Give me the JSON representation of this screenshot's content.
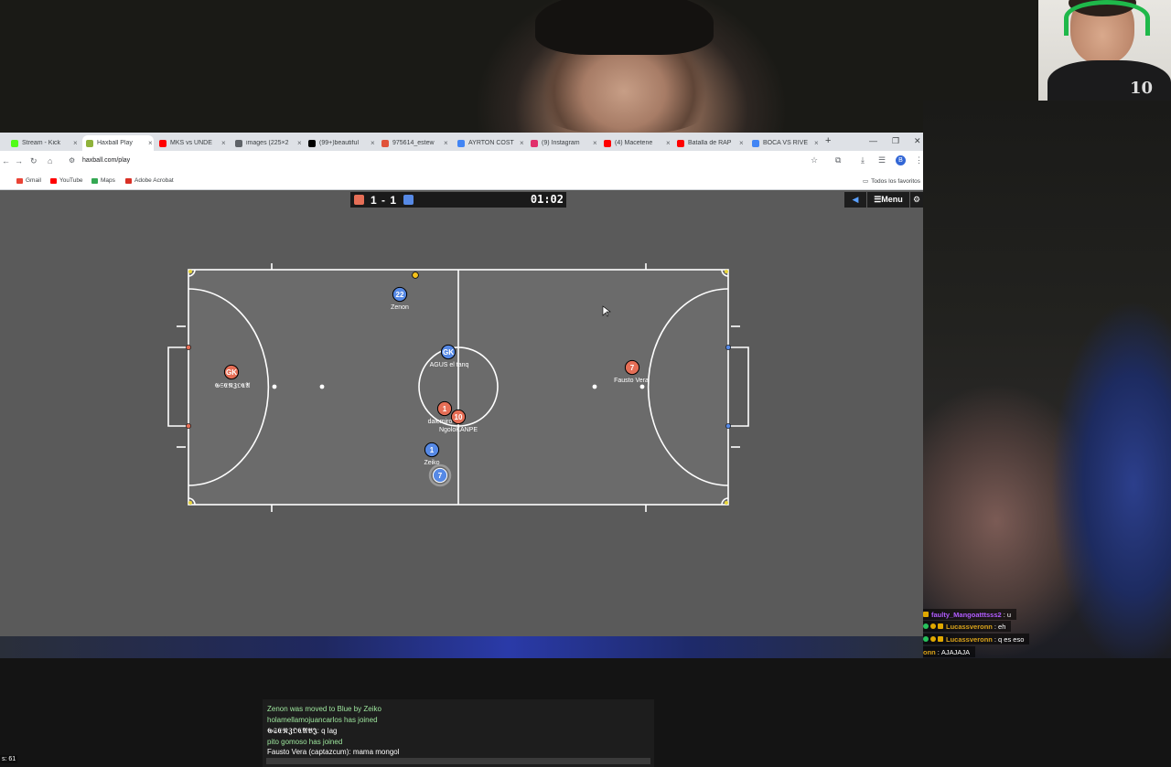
{
  "browser": {
    "tabs": [
      {
        "label": "Stream - Kick",
        "color": "#53fc18",
        "active": false
      },
      {
        "label": "Haxball Play",
        "color": "#8fb23a",
        "active": true
      },
      {
        "label": "MKS vs UNDE",
        "color": "#ff0000",
        "active": false
      },
      {
        "label": "images (225×2",
        "color": "#5f6368",
        "active": false
      },
      {
        "label": "(99+)beautiful",
        "color": "#000000",
        "active": false
      },
      {
        "label": "975614_estew",
        "color": "#e0523a",
        "active": false
      },
      {
        "label": "AYRTON COST",
        "color": "#4285f4",
        "active": false
      },
      {
        "label": "(9) Instagram",
        "color": "#e1306c",
        "active": false
      },
      {
        "label": "(4) Macetene",
        "color": "#ff0000",
        "active": false
      },
      {
        "label": "Batalla de RAP",
        "color": "#ff0000",
        "active": false
      },
      {
        "label": "BOCA VS RIVE",
        "color": "#4285f4",
        "active": false
      }
    ],
    "url": "haxball.com/play",
    "bookmarks": [
      {
        "label": "Gmail",
        "color": "#ea4335"
      },
      {
        "label": "YouTube",
        "color": "#ff0000"
      },
      {
        "label": "Maps",
        "color": "#34a853"
      },
      {
        "label": "Adobe Acrobat",
        "color": "#d93025"
      }
    ],
    "all_favorites": "Todos los favoritos",
    "profile_initial": "B"
  },
  "game": {
    "score": "1 - 1",
    "timer": "01:02",
    "red_color": "#e56e56",
    "blue_color": "#5689e5",
    "menu_label": "☰Menu",
    "players": [
      {
        "team": "blue",
        "number": "22",
        "name": "Zenon"
      },
      {
        "team": "blue",
        "number": "GK",
        "name": "AGUS el tanq"
      },
      {
        "team": "red",
        "number": "GK",
        "name": "𝕲𝕾𝕰𝕹𝖅𝕺𝕮𝕬"
      },
      {
        "team": "red",
        "number": "1",
        "name": "dalemiro"
      },
      {
        "team": "red",
        "number": "10",
        "name": "NgoloKANPE"
      },
      {
        "team": "blue",
        "number": "1",
        "name": "Zeiko"
      },
      {
        "team": "blue",
        "number": "7",
        "name": ""
      },
      {
        "team": "red",
        "number": "7",
        "name": "Fausto Vera"
      }
    ],
    "chat": [
      {
        "text": "Zenon was moved to Blue by Zeiko",
        "color": "#9fe89f"
      },
      {
        "text": "holamellamojuancarlos has joined",
        "color": "#9fe89f"
      },
      {
        "text": "𝕲𝕾𝕰𝕹𝖅𝕺𝕮𝕬𝕭𝕵: q lag",
        "color": "#ffffff"
      },
      {
        "text": "pito gomoso has joined",
        "color": "#9fe89f"
      },
      {
        "text": "Fausto Vera (captazcum): mama mongol",
        "color": "#ffffff"
      }
    ],
    "ping_label": "s: 61"
  },
  "twitch_chat": [
    {
      "user": "faulty_Mangoatttsss2",
      "message": "u",
      "color": "#b25cff"
    },
    {
      "user": "Lucassveronn",
      "message": "eh",
      "color": "#d9a21a"
    },
    {
      "user": "Lucassveronn",
      "message": "q es eso",
      "color": "#d9a21a"
    },
    {
      "user": "onn",
      "message": "AJAJAJA",
      "color": "#d9a21a"
    }
  ],
  "webcam_shirt_text": "10"
}
